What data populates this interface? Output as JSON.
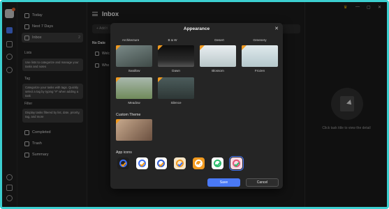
{
  "colors": {
    "accent": "#4a79f5",
    "frame": "#3ccfd0",
    "premium": "#f19a1f"
  },
  "sidebar": {
    "nav": [
      {
        "label": "Today",
        "count": ""
      },
      {
        "label": "Next 7 Days",
        "count": ""
      },
      {
        "label": "Inbox",
        "count": "2"
      }
    ],
    "lists_title": "Lists",
    "lists_tip": "Use lists to categorize and manage your tasks and notes",
    "tags_title": "Tag",
    "tags_tip": "Categorize your tasks with tags. Quickly select a tag by typing \"#\" when adding a task",
    "filter_title": "Filter",
    "filter_tip": "Display tasks filtered by list, date, priority, tag, and more",
    "footer": [
      {
        "label": "Completed"
      },
      {
        "label": "Trash"
      },
      {
        "label": "Summary"
      }
    ]
  },
  "main": {
    "title": "Inbox",
    "add_placeholder": "+ Add t",
    "group": "No Date",
    "rows": [
      "Welc",
      "Who"
    ]
  },
  "detail": {
    "hint": "Click task title to view the detail"
  },
  "modal": {
    "title": "Appearance",
    "categories": [
      "Architecture",
      "B & W",
      "Desert",
      "Greenery"
    ],
    "themes": [
      {
        "name": "Swallow"
      },
      {
        "name": "Dawn"
      },
      {
        "name": "Blossom"
      },
      {
        "name": "Frozen"
      },
      {
        "name": "Meadow"
      },
      {
        "name": "Silence"
      }
    ],
    "custom_theme_title": "Custom Theme",
    "app_icons_title": "App icons",
    "save_label": "Save",
    "cancel_label": "Cancel"
  }
}
